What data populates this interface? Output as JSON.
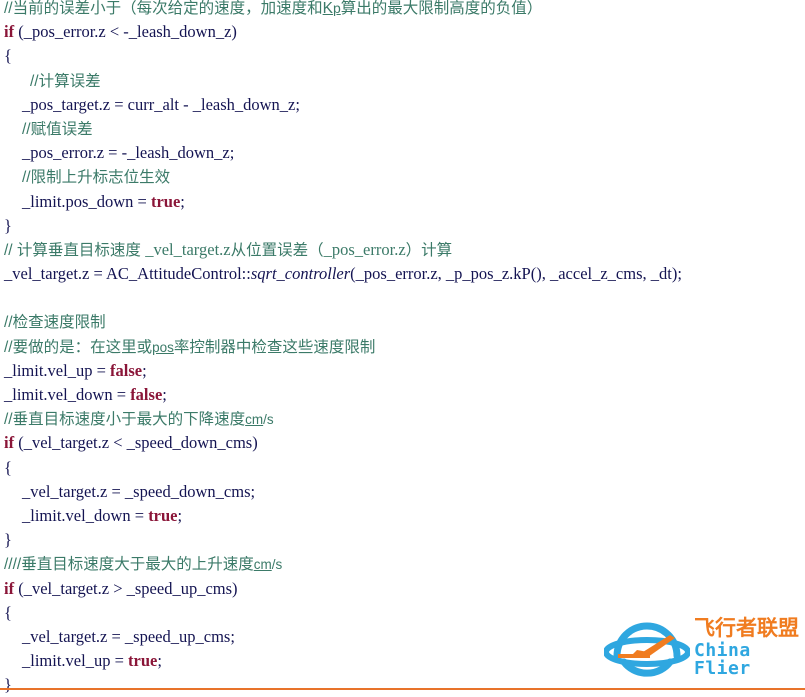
{
  "document": {
    "type": "cpp-code-snippet",
    "background": "#ffffff",
    "colors": {
      "comment": "#3b7a68",
      "code": "#141452",
      "keyword": "#8a1538",
      "logo_orange": "#f07c20",
      "logo_blue": "#2fa7e0",
      "rule_orange": "#e8732a"
    }
  },
  "code": {
    "lines": [
      {
        "id": "l1",
        "indent": 0,
        "kind": "comment",
        "text": "//当前的误差小于（每次给定的速度，加速度和Kp算出的最大限制高度的负值）"
      },
      {
        "id": "l2",
        "indent": 0,
        "kind": "code",
        "text": "if (_pos_error.z < -_leash_down_z)"
      },
      {
        "id": "l3",
        "indent": 0,
        "kind": "code",
        "text": "{"
      },
      {
        "id": "l4",
        "indent": 2,
        "kind": "comment",
        "text": "//计算误差"
      },
      {
        "id": "l5",
        "indent": 1,
        "kind": "code",
        "text": "_pos_target.z = curr_alt - _leash_down_z;"
      },
      {
        "id": "l6",
        "indent": 1,
        "kind": "comment",
        "text": "//赋值误差"
      },
      {
        "id": "l7",
        "indent": 1,
        "kind": "code",
        "text": "_pos_error.z = -_leash_down_z;"
      },
      {
        "id": "l8",
        "indent": 1,
        "kind": "comment",
        "text": "//限制上升标志位生效"
      },
      {
        "id": "l9",
        "indent": 1,
        "kind": "code",
        "text": "_limit.pos_down = true;"
      },
      {
        "id": "l10",
        "indent": 0,
        "kind": "code",
        "text": "}"
      },
      {
        "id": "l11",
        "indent": 0,
        "kind": "comment",
        "text": "// 计算垂直目标速度 _vel_target.z从位置误差（_pos_error.z）计算"
      },
      {
        "id": "l12",
        "indent": 0,
        "kind": "code",
        "text": "_vel_target.z = AC_AttitudeControl::sqrt_controller(_pos_error.z, _p_pos_z.kP(), _accel_z_cms, _dt);"
      },
      {
        "id": "l13",
        "indent": 0,
        "kind": "blank",
        "text": ""
      },
      {
        "id": "l14",
        "indent": 0,
        "kind": "comment",
        "text": "//检查速度限制"
      },
      {
        "id": "l15",
        "indent": 0,
        "kind": "comment",
        "text": "//要做的是：在这里或pos率控制器中检查这些速度限制"
      },
      {
        "id": "l16",
        "indent": 0,
        "kind": "code",
        "text": "_limit.vel_up = false;"
      },
      {
        "id": "l17",
        "indent": 0,
        "kind": "code",
        "text": "_limit.vel_down = false;"
      },
      {
        "id": "l18",
        "indent": 0,
        "kind": "comment",
        "text": "//垂直目标速度小于最大的下降速度cm/s"
      },
      {
        "id": "l19",
        "indent": 0,
        "kind": "code",
        "text": "if (_vel_target.z < _speed_down_cms)"
      },
      {
        "id": "l20",
        "indent": 0,
        "kind": "code",
        "text": "{"
      },
      {
        "id": "l21",
        "indent": 1,
        "kind": "code",
        "text": "_vel_target.z = _speed_down_cms;"
      },
      {
        "id": "l22",
        "indent": 1,
        "kind": "code",
        "text": "_limit.vel_down = true;"
      },
      {
        "id": "l23",
        "indent": 0,
        "kind": "code",
        "text": "}"
      },
      {
        "id": "l24",
        "indent": 0,
        "kind": "comment",
        "text": "////垂直目标速度大于最大的上升速度cm/s"
      },
      {
        "id": "l25",
        "indent": 0,
        "kind": "code",
        "text": "if (_vel_target.z > _speed_up_cms)"
      },
      {
        "id": "l26",
        "indent": 0,
        "kind": "code",
        "text": "{"
      },
      {
        "id": "l27",
        "indent": 1,
        "kind": "code",
        "text": "_vel_target.z = _speed_up_cms;"
      },
      {
        "id": "l28",
        "indent": 1,
        "kind": "code",
        "text": "_limit.vel_up = true;"
      },
      {
        "id": "l29",
        "indent": 0,
        "kind": "code",
        "text": "}"
      }
    ]
  },
  "logo": {
    "mark_name": "planet-ring-airplane-icon",
    "cn_text": "飞行者联盟",
    "en_text": "China Flier"
  }
}
